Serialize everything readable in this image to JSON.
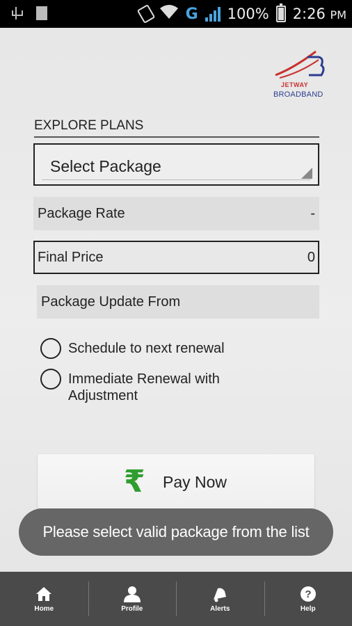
{
  "status_bar": {
    "battery_percent": "100%",
    "time": "2:26",
    "ampm": "PM",
    "network_type": "G",
    "icons": [
      "usb-icon",
      "sim-icon",
      "rotate-icon",
      "wifi-icon",
      "signal-icon",
      "battery-icon"
    ]
  },
  "logo": {
    "line1": "JETWAY",
    "line2": "BROADBAND",
    "colors": {
      "red": "#c8322f",
      "blue": "#2a3d8f"
    }
  },
  "form": {
    "section_title": "EXPLORE PLANS",
    "select_package": "Select Package",
    "package_rate_label": "Package Rate",
    "package_rate_value": "-",
    "final_price_label": "Final Price",
    "final_price_value": "0",
    "package_update_label": "Package Update From",
    "radio_options": [
      {
        "label": "Schedule to next renewal",
        "selected": false
      },
      {
        "label": "Immediate Renewal with Adjustment",
        "selected": false
      }
    ]
  },
  "pay_button": {
    "icon": "rupee-icon",
    "label": "Pay Now",
    "icon_color": "#2e9e2e"
  },
  "toast": {
    "message": "Please select valid package from the list"
  },
  "bottom_nav": {
    "items": [
      {
        "label": "Home",
        "icon": "home-icon"
      },
      {
        "label": "Profile",
        "icon": "profile-icon"
      },
      {
        "label": "Alerts",
        "icon": "alerts-icon"
      },
      {
        "label": "Help",
        "icon": "help-icon"
      }
    ]
  }
}
